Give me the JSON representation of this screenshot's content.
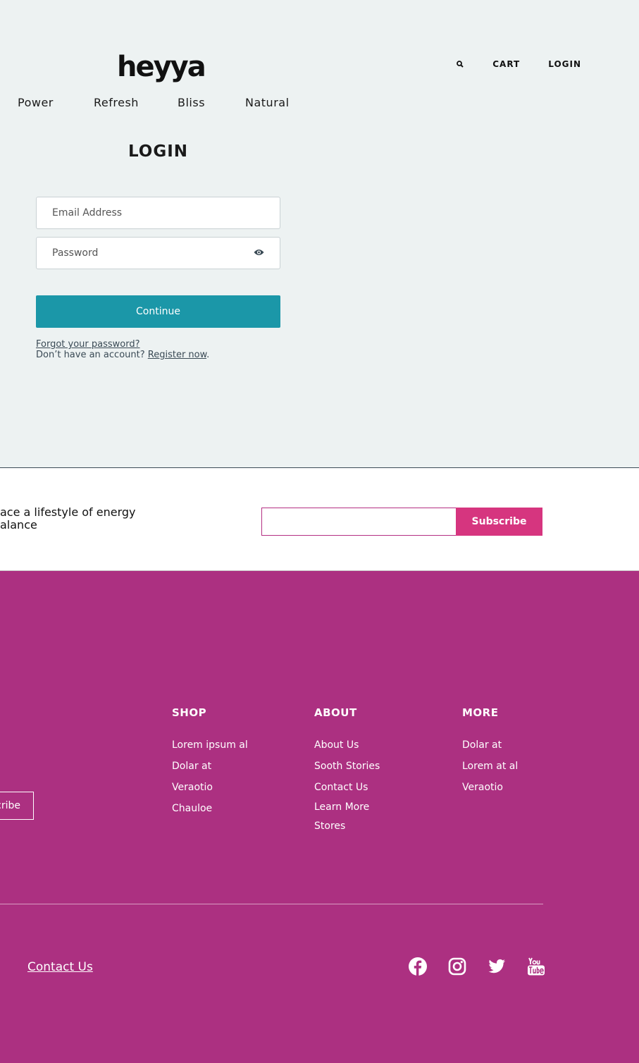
{
  "brand": {
    "logo_text": "heyya"
  },
  "top_nav": {
    "search_icon": "search-icon",
    "cart": "CART",
    "login": "LOGIN"
  },
  "categories": [
    "Power",
    "Refresh",
    "Bliss",
    "Natural"
  ],
  "login": {
    "title": "LOGIN",
    "email_placeholder": "Email Address",
    "password_placeholder": "Password",
    "show_password_icon": "eye-icon",
    "continue_label": "Continue",
    "forgot_password": "Forgot your password?",
    "no_account": "Don’t have an account? ",
    "register": "Register now",
    "period": "."
  },
  "newsletter": {
    "text_line1": "ace a lifestyle of energy",
    "text_line2": "alance",
    "subscribe_label": "Subscribe"
  },
  "footer": {
    "subscribe_partial": "cribe",
    "columns": [
      {
        "title": "SHOP",
        "items": [
          "Lorem ipsum al",
          "Dolar at",
          "Veraotio",
          "Chauloe"
        ]
      },
      {
        "title": "ABOUT",
        "items": [
          "About Us",
          "Sooth Stories",
          "Contact Us",
          "Learn More",
          "Stores"
        ]
      },
      {
        "title": "MORE",
        "items": [
          "Dolar at",
          "Lorem at al",
          "Veraotio"
        ]
      }
    ],
    "contact_us": "Contact Us",
    "socials": [
      "facebook-icon",
      "instagram-icon",
      "twitter-icon",
      "youtube-icon"
    ]
  },
  "colors": {
    "background": "#edf2f2",
    "accent": "#1b97a8",
    "footer": "#ac3081",
    "subscribe": "#d6357f"
  }
}
